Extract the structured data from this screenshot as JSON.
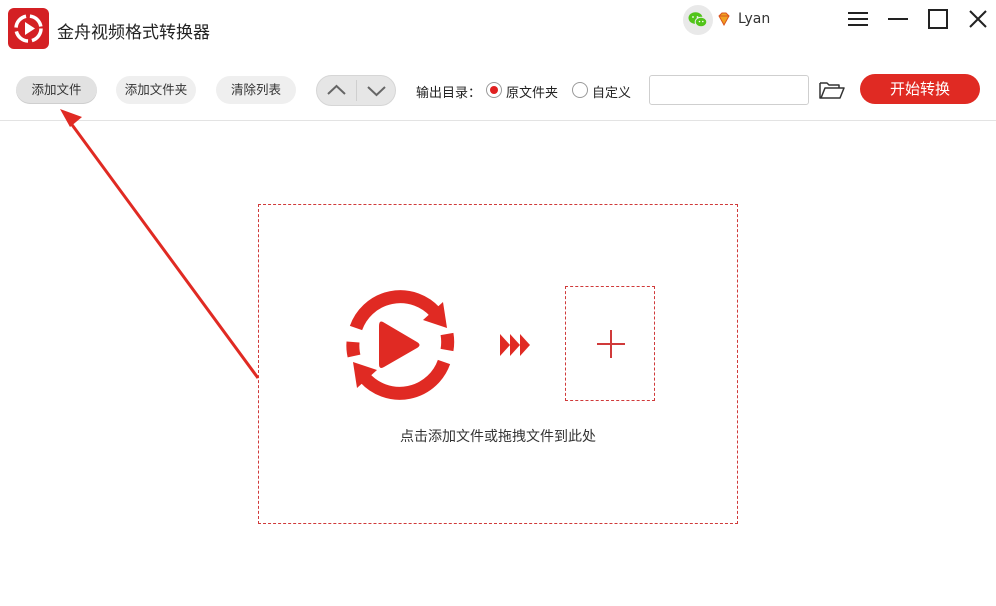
{
  "app": {
    "title": "金舟视频格式转换器",
    "username": "Lyan",
    "brand_color": "#e02a23"
  },
  "window_controls": {
    "menu_icon": "hamburger-menu-icon",
    "minimize_icon": "minimize-icon",
    "maximize_icon": "maximize-icon",
    "close_icon": "close-icon"
  },
  "toolbar": {
    "add_file": "添加文件",
    "add_folder": "添加文件夹",
    "clear_list": "清除列表",
    "output_dir_label": "输出目录：",
    "output_options": {
      "original": "原文件夹",
      "custom": "自定义",
      "selected": "original"
    },
    "path_value": "",
    "start": "开始转换"
  },
  "dropzone": {
    "hint": "点击添加文件或拖拽文件到此处"
  }
}
